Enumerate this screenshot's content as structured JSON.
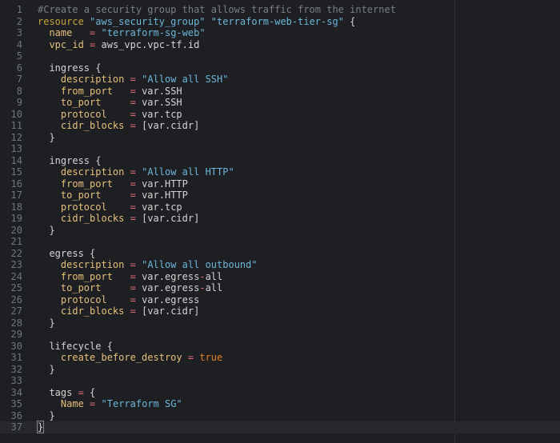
{
  "editor": {
    "lines": [
      [
        {
          "t": "#Create a security group that allows traffic from the internet",
          "c": "comment"
        }
      ],
      [
        {
          "t": "resource",
          "c": "keyword"
        },
        {
          "t": " ",
          "c": "punct"
        },
        {
          "t": "\"aws_security_group\"",
          "c": "string"
        },
        {
          "t": " ",
          "c": "punct"
        },
        {
          "t": "\"terraform-web-tier-sg\"",
          "c": "string"
        },
        {
          "t": " {",
          "c": "punct"
        }
      ],
      [
        {
          "t": "  ",
          "c": "punct"
        },
        {
          "t": "name",
          "c": "attr"
        },
        {
          "t": "   ",
          "c": "punct"
        },
        {
          "t": "=",
          "c": "op"
        },
        {
          "t": " ",
          "c": "punct"
        },
        {
          "t": "\"terraform-sg-web\"",
          "c": "string"
        }
      ],
      [
        {
          "t": "  ",
          "c": "punct"
        },
        {
          "t": "vpc_id",
          "c": "attr"
        },
        {
          "t": " ",
          "c": "punct"
        },
        {
          "t": "=",
          "c": "op"
        },
        {
          "t": " aws_vpc.vpc-tf.id",
          "c": "ident"
        }
      ],
      [],
      [
        {
          "t": "  ingress {",
          "c": "ident"
        }
      ],
      [
        {
          "t": "    ",
          "c": "punct"
        },
        {
          "t": "description",
          "c": "attr"
        },
        {
          "t": " ",
          "c": "punct"
        },
        {
          "t": "=",
          "c": "op"
        },
        {
          "t": " ",
          "c": "punct"
        },
        {
          "t": "\"Allow all SSH\"",
          "c": "string"
        }
      ],
      [
        {
          "t": "    ",
          "c": "punct"
        },
        {
          "t": "from_port",
          "c": "attr"
        },
        {
          "t": "   ",
          "c": "punct"
        },
        {
          "t": "=",
          "c": "op"
        },
        {
          "t": " var.SSH",
          "c": "ident"
        }
      ],
      [
        {
          "t": "    ",
          "c": "punct"
        },
        {
          "t": "to_port",
          "c": "attr"
        },
        {
          "t": "     ",
          "c": "punct"
        },
        {
          "t": "=",
          "c": "op"
        },
        {
          "t": " var.SSH",
          "c": "ident"
        }
      ],
      [
        {
          "t": "    ",
          "c": "punct"
        },
        {
          "t": "protocol",
          "c": "attr"
        },
        {
          "t": "    ",
          "c": "punct"
        },
        {
          "t": "=",
          "c": "op"
        },
        {
          "t": " var.tcp",
          "c": "ident"
        }
      ],
      [
        {
          "t": "    ",
          "c": "punct"
        },
        {
          "t": "cidr_blocks",
          "c": "attr"
        },
        {
          "t": " ",
          "c": "punct"
        },
        {
          "t": "=",
          "c": "op"
        },
        {
          "t": " [var.cidr]",
          "c": "ident"
        }
      ],
      [
        {
          "t": "  }",
          "c": "punct"
        }
      ],
      [],
      [
        {
          "t": "  ingress {",
          "c": "ident"
        }
      ],
      [
        {
          "t": "    ",
          "c": "punct"
        },
        {
          "t": "description",
          "c": "attr"
        },
        {
          "t": " ",
          "c": "punct"
        },
        {
          "t": "=",
          "c": "op"
        },
        {
          "t": " ",
          "c": "punct"
        },
        {
          "t": "\"Allow all HTTP\"",
          "c": "string"
        }
      ],
      [
        {
          "t": "    ",
          "c": "punct"
        },
        {
          "t": "from_port",
          "c": "attr"
        },
        {
          "t": "   ",
          "c": "punct"
        },
        {
          "t": "=",
          "c": "op"
        },
        {
          "t": " var.HTTP",
          "c": "ident"
        }
      ],
      [
        {
          "t": "    ",
          "c": "punct"
        },
        {
          "t": "to_port",
          "c": "attr"
        },
        {
          "t": "     ",
          "c": "punct"
        },
        {
          "t": "=",
          "c": "op"
        },
        {
          "t": " var.HTTP",
          "c": "ident"
        }
      ],
      [
        {
          "t": "    ",
          "c": "punct"
        },
        {
          "t": "protocol",
          "c": "attr"
        },
        {
          "t": "    ",
          "c": "punct"
        },
        {
          "t": "=",
          "c": "op"
        },
        {
          "t": " var.tcp",
          "c": "ident"
        }
      ],
      [
        {
          "t": "    ",
          "c": "punct"
        },
        {
          "t": "cidr_blocks",
          "c": "attr"
        },
        {
          "t": " ",
          "c": "punct"
        },
        {
          "t": "=",
          "c": "op"
        },
        {
          "t": " [var.cidr]",
          "c": "ident"
        }
      ],
      [
        {
          "t": "  }",
          "c": "punct"
        }
      ],
      [],
      [
        {
          "t": "  egress {",
          "c": "ident"
        }
      ],
      [
        {
          "t": "    ",
          "c": "punct"
        },
        {
          "t": "description",
          "c": "attr"
        },
        {
          "t": " ",
          "c": "punct"
        },
        {
          "t": "=",
          "c": "op"
        },
        {
          "t": " ",
          "c": "punct"
        },
        {
          "t": "\"Allow all outbound\"",
          "c": "string"
        }
      ],
      [
        {
          "t": "    ",
          "c": "punct"
        },
        {
          "t": "from_port",
          "c": "attr"
        },
        {
          "t": "   ",
          "c": "punct"
        },
        {
          "t": "=",
          "c": "op"
        },
        {
          "t": " var.egress",
          "c": "ident"
        },
        {
          "t": "-",
          "c": "op"
        },
        {
          "t": "all",
          "c": "ident"
        }
      ],
      [
        {
          "t": "    ",
          "c": "punct"
        },
        {
          "t": "to_port",
          "c": "attr"
        },
        {
          "t": "     ",
          "c": "punct"
        },
        {
          "t": "=",
          "c": "op"
        },
        {
          "t": " var.egress",
          "c": "ident"
        },
        {
          "t": "-",
          "c": "op"
        },
        {
          "t": "all",
          "c": "ident"
        }
      ],
      [
        {
          "t": "    ",
          "c": "punct"
        },
        {
          "t": "protocol",
          "c": "attr"
        },
        {
          "t": "    ",
          "c": "punct"
        },
        {
          "t": "=",
          "c": "op"
        },
        {
          "t": " var.egress",
          "c": "ident"
        }
      ],
      [
        {
          "t": "    ",
          "c": "punct"
        },
        {
          "t": "cidr_blocks",
          "c": "attr"
        },
        {
          "t": " ",
          "c": "punct"
        },
        {
          "t": "=",
          "c": "op"
        },
        {
          "t": " [var.cidr]",
          "c": "ident"
        }
      ],
      [
        {
          "t": "  }",
          "c": "punct"
        }
      ],
      [],
      [
        {
          "t": "  lifecycle {",
          "c": "ident"
        }
      ],
      [
        {
          "t": "    ",
          "c": "punct"
        },
        {
          "t": "create_before_destroy",
          "c": "attr"
        },
        {
          "t": " ",
          "c": "punct"
        },
        {
          "t": "=",
          "c": "op"
        },
        {
          "t": " ",
          "c": "punct"
        },
        {
          "t": "true",
          "c": "bool"
        }
      ],
      [
        {
          "t": "  }",
          "c": "punct"
        }
      ],
      [],
      [
        {
          "t": "  ",
          "c": "punct"
        },
        {
          "t": "tags",
          "c": "ident"
        },
        {
          "t": " ",
          "c": "punct"
        },
        {
          "t": "=",
          "c": "op"
        },
        {
          "t": " {",
          "c": "punct"
        }
      ],
      [
        {
          "t": "    ",
          "c": "punct"
        },
        {
          "t": "Name",
          "c": "attr"
        },
        {
          "t": " ",
          "c": "punct"
        },
        {
          "t": "=",
          "c": "op"
        },
        {
          "t": " ",
          "c": "punct"
        },
        {
          "t": "\"Terraform SG\"",
          "c": "string"
        }
      ],
      [
        {
          "t": "  }",
          "c": "punct"
        }
      ],
      [
        {
          "t": "}",
          "c": "punct",
          "cursor": true
        }
      ]
    ],
    "active_line": 37
  },
  "colors": {
    "background": "#1e1f22",
    "comment": "#7a7e85",
    "keyword": "#c7a43a",
    "string": "#6cb6d9",
    "attribute": "#e5c07b",
    "operator": "#e06c75",
    "boolean": "#e67e22",
    "line_number": "#6e7681"
  }
}
